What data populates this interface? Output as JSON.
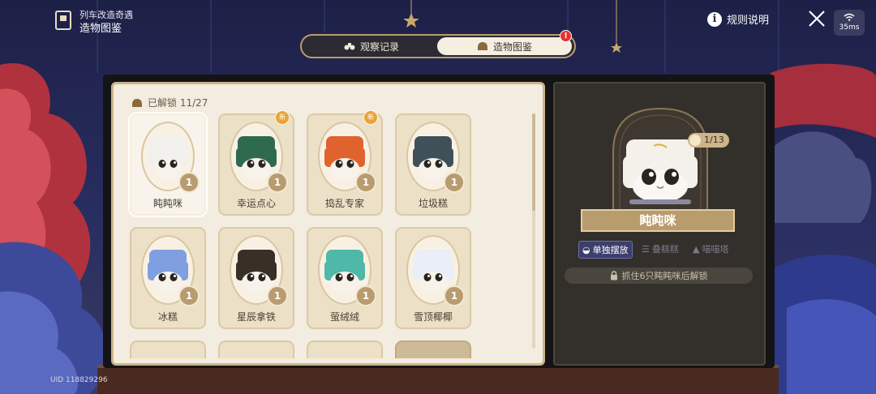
{
  "header": {
    "subtitle": "列车改造奇遇",
    "title": "造物图鉴"
  },
  "top_right": {
    "rules_label": "规则说明",
    "ping": "35ms"
  },
  "tabs": [
    {
      "label": "观察记录",
      "icon": "binoculars-icon",
      "active": false
    },
    {
      "label": "造物图鉴",
      "icon": "bun-icon",
      "active": true
    }
  ],
  "tab_alert": "!",
  "collection": {
    "unlocked_label": "已解锁 11/27"
  },
  "cards": [
    {
      "name": "盹盹咪",
      "count": "1",
      "new": false,
      "selected": true,
      "color": "#f2f0ec"
    },
    {
      "name": "幸运点心",
      "count": "1",
      "new": true,
      "new_label": "新",
      "color": "#2f6a4f"
    },
    {
      "name": "捣乱专家",
      "count": "1",
      "new": true,
      "new_label": "新",
      "color": "#e0632d"
    },
    {
      "name": "垃圾糕",
      "count": "1",
      "new": false,
      "color": "#3f5058"
    },
    {
      "name": "冰糕",
      "count": "1",
      "new": false,
      "color": "#7f9fe0"
    },
    {
      "name": "星辰拿铁",
      "count": "1",
      "new": false,
      "color": "#3a2f26"
    },
    {
      "name": "萤绒绒",
      "count": "1",
      "new": false,
      "color": "#4fb8a8"
    },
    {
      "name": "雪顶椰椰",
      "count": "1",
      "new": false,
      "color": "#e9eef8"
    }
  ],
  "detail": {
    "progress": "1/13",
    "name": "盹盹咪",
    "options": [
      {
        "label": "单独摆放",
        "active": true
      },
      {
        "label": "叠糕糕",
        "active": false
      },
      {
        "label": "喵喵塔",
        "active": false
      }
    ],
    "unlock_hint": "抓住6只盹盹咪后解锁"
  },
  "uid": "UID 118829296",
  "colors": {
    "panel_border": "#cdb48a",
    "accent_gold": "#b89c6e",
    "detail_bg": "#33302b"
  }
}
